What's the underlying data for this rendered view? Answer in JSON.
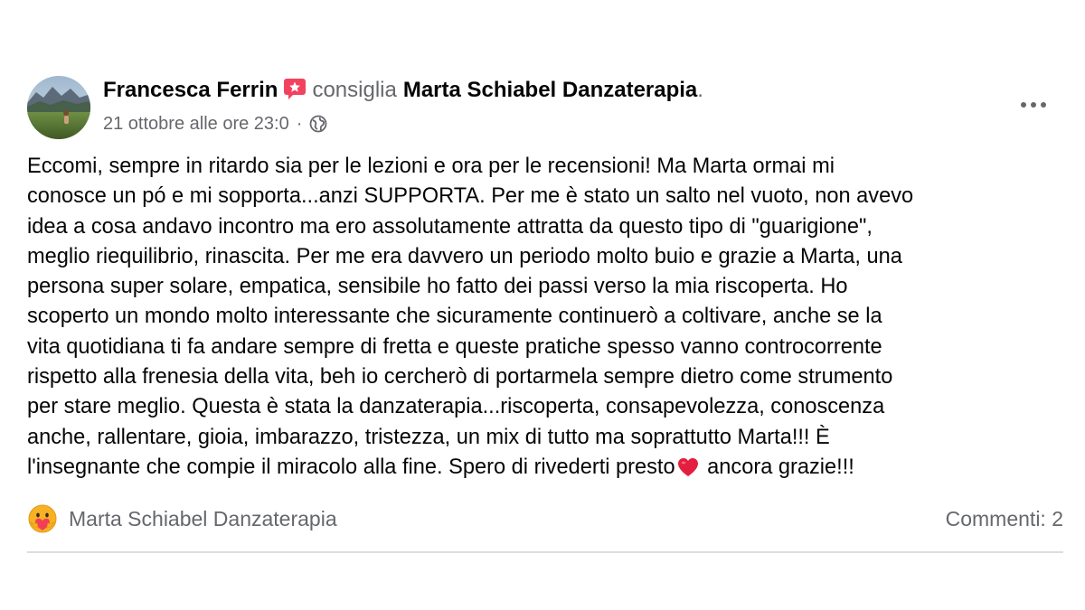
{
  "post": {
    "author": "Francesca Ferrin",
    "action": "consiglia",
    "page": "Marta Schiabel Danzaterapia",
    "punctuation": ".",
    "timestamp": "21 ottobre alle ore 23:0",
    "separator": "·",
    "privacy_icon": "globe-icon",
    "menu_icon": "more-options-icon",
    "body_lines": [
      "Eccomi, sempre in ritardo sia per le lezioni e ora per le recensioni! Ma Marta ormai mi",
      "conosce un pó e mi sopporta...anzi SUPPORTA. Per me è stato un salto nel vuoto, non avevo",
      "idea a cosa andavo incontro ma ero assolutamente attratta da questo tipo di \"guarigione\",",
      "meglio riequilibrio, rinascita. Per me era davvero un periodo molto buio e grazie a Marta, una",
      "persona super solare, empatica, sensibile ho fatto dei passi verso la mia riscoperta. Ho",
      "scoperto un mondo molto interessante che sicuramente continuerò a coltivare, anche se la",
      "vita quotidiana ti fa andare sempre di fretta e queste pratiche spesso vanno controcorrente",
      "rispetto alla frenesia della vita, beh io cercherò di portarmela sempre dietro come strumento",
      "per stare meglio. Questa è stata la danzaterapia...riscoperta, consapevolezza, conoscenza",
      "anche, rallentare, gioia, imbarazzo, tristezza, un mix di tutto ma soprattutto Marta!!! È"
    ],
    "last_line_before_heart": "l'insegnante che compie il miracolo alla fine. Spero di rivederti presto",
    "last_line_after_heart": " ancora grazie!!!"
  },
  "footer": {
    "reaction_icon": "care-reaction-icon",
    "reaction_name": "Marta Schiabel Danzaterapia",
    "comments": "Commenti: 2"
  },
  "colors": {
    "primary_text": "#050505",
    "secondary_text": "#65676b",
    "recommend_badge": "#f3425f",
    "heart": "#e41e3f",
    "divider": "#dadde1"
  }
}
